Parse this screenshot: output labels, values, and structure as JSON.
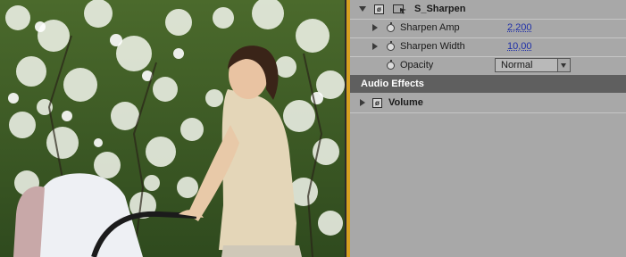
{
  "preview": {
    "description_icon": "video-frame"
  },
  "effects": {
    "s_sharpen": {
      "name": "S_Sharpen",
      "expanded": true,
      "params": [
        {
          "label": "Sharpen Amp",
          "value": "2,200"
        },
        {
          "label": "Sharpen Width",
          "value": "10,00"
        },
        {
          "label": "Opacity",
          "value": "Normal"
        }
      ]
    }
  },
  "audio_section": {
    "title": "Audio Effects",
    "items": [
      {
        "name": "Volume",
        "expanded": false
      }
    ]
  },
  "colors": {
    "accent": "#d6a021",
    "section_bg": "#5f5f5f",
    "panel_bg": "#a8a8a8",
    "value_link": "#1d2ea8"
  }
}
